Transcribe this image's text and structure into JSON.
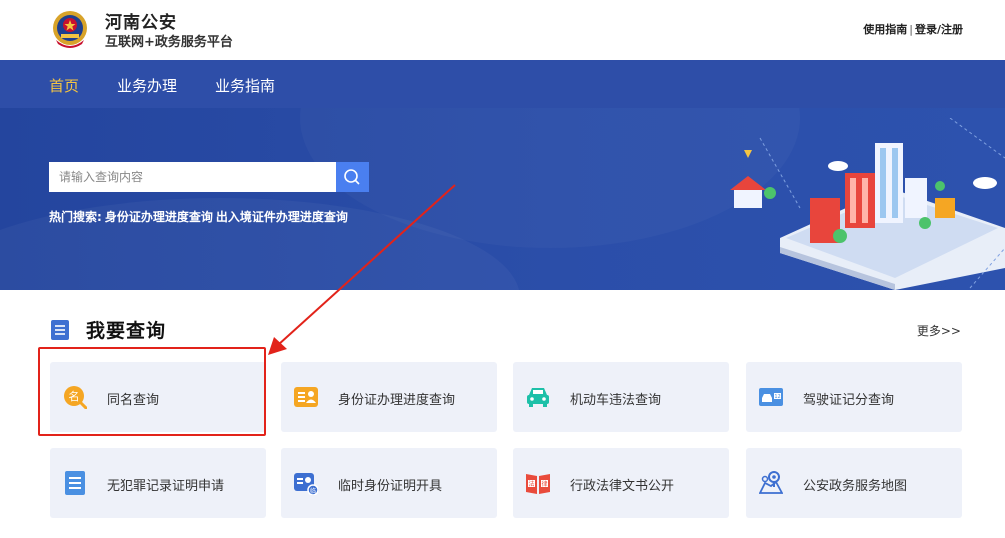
{
  "header": {
    "title": "河南公安",
    "subtitle": "互联网+政务服务平台",
    "links": [
      "使用指南",
      "登录/注册"
    ],
    "separator": "|"
  },
  "nav": {
    "items": [
      {
        "label": "首页",
        "active": true
      },
      {
        "label": "业务办理",
        "active": false
      },
      {
        "label": "业务指南",
        "active": false
      }
    ]
  },
  "search": {
    "placeholder": "请输入查询内容",
    "hot_label": "热门搜索:",
    "hot_items": [
      "身份证办理进度查询",
      "出入境证件办理进度查询"
    ]
  },
  "section": {
    "title": "我要查询",
    "more": "更多>>"
  },
  "cards": [
    {
      "label": "同名查询",
      "icon": "name-search-icon",
      "color": "#f5a623"
    },
    {
      "label": "身份证办理进度查询",
      "icon": "id-card-icon",
      "color": "#f5a623"
    },
    {
      "label": "机动车违法查询",
      "icon": "car-icon",
      "color": "#1dc0a8"
    },
    {
      "label": "驾驶证记分查询",
      "icon": "license-icon",
      "color": "#4a90e2"
    },
    {
      "label": "无犯罪记录证明申请",
      "icon": "document-icon",
      "color": "#4a90e2"
    },
    {
      "label": "临时身份证明开具",
      "icon": "temp-id-icon",
      "color": "#3d6fd1"
    },
    {
      "label": "行政法律文书公开",
      "icon": "law-book-icon",
      "color": "#e94b3c"
    },
    {
      "label": "公安政务服务地图",
      "icon": "map-icon",
      "color": "#3d6fd1"
    }
  ],
  "colors": {
    "nav_bg": "#2e4ea8",
    "nav_active": "#f5c542",
    "banner_bg": "#2b4ea9",
    "search_button": "#4a7ff0",
    "card_bg": "#eef1f9",
    "highlight": "#e2231a"
  }
}
